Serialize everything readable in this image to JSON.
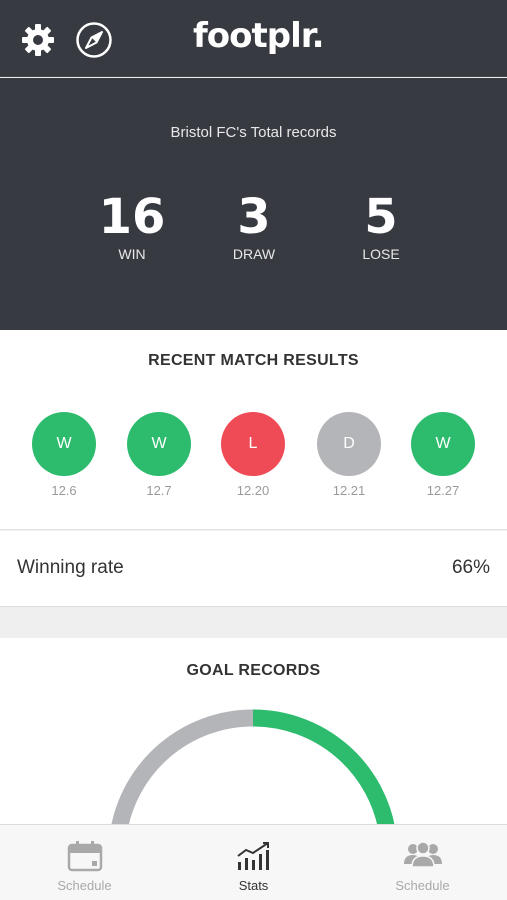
{
  "header": {
    "logo": "footplr.",
    "settings_icon": "gear-icon",
    "explore_icon": "compass-icon"
  },
  "records": {
    "title": "Bristol FC's Total records",
    "win": {
      "value": "16",
      "label": "WIN"
    },
    "draw": {
      "value": "3",
      "label": "DRAW"
    },
    "lose": {
      "value": "5",
      "label": "LOSE"
    }
  },
  "recent": {
    "title": "RECENT MATCH RESULTS",
    "matches": [
      {
        "result": "W",
        "date": "12.6",
        "color": "#2dbb6e"
      },
      {
        "result": "W",
        "date": "12.7",
        "color": "#2dbb6e"
      },
      {
        "result": "L",
        "date": "12.20",
        "color": "#ef4b57"
      },
      {
        "result": "D",
        "date": "12.21",
        "color": "#b3b5b8"
      },
      {
        "result": "W",
        "date": "12.27",
        "color": "#2dbb6e"
      }
    ]
  },
  "winning_rate": {
    "label": "Winning rate",
    "value": "66%"
  },
  "goals": {
    "title": "GOAL RECORDS",
    "gauge_colors": {
      "scored": "#2dbb6e",
      "conceded": "#b3b5b8"
    }
  },
  "tabs": [
    {
      "label": "Schedule",
      "icon": "calendar-icon",
      "active": false
    },
    {
      "label": "Stats",
      "icon": "chart-icon",
      "active": true
    },
    {
      "label": "Schedule",
      "icon": "team-icon",
      "active": false
    }
  ],
  "colors": {
    "header_bg": "#373a41",
    "win": "#2dbb6e",
    "lose": "#ef4b57",
    "draw": "#b3b5b8"
  }
}
